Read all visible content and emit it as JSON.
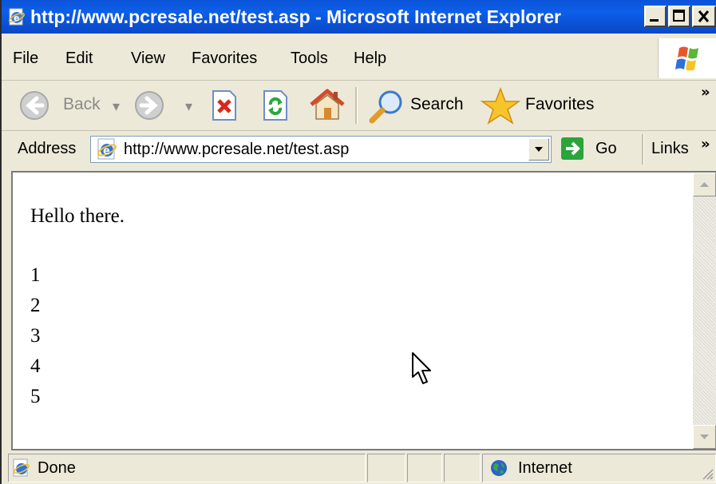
{
  "window": {
    "title": "http://www.pcresale.net/test.asp - Microsoft Internet Explorer"
  },
  "menu": [
    "File",
    "Edit",
    "View",
    "Favorites",
    "Tools",
    "Help"
  ],
  "toolbar": {
    "back_label": "Back",
    "search_label": "Search",
    "favorites_label": "Favorites",
    "overflow": "»"
  },
  "address": {
    "label": "Address",
    "url": "http://www.pcresale.net/test.asp",
    "go_label": "Go",
    "links_label": "Links",
    "overflow": "»"
  },
  "content": {
    "greeting": "Hello there.",
    "numbers": [
      "1",
      "2",
      "3",
      "4",
      "5"
    ]
  },
  "status": {
    "text": "Done",
    "zone": "Internet"
  },
  "colors": {
    "titlebar": "#0a53d8",
    "chrome": "#ece9d8",
    "page_bg": "#ffffff"
  }
}
